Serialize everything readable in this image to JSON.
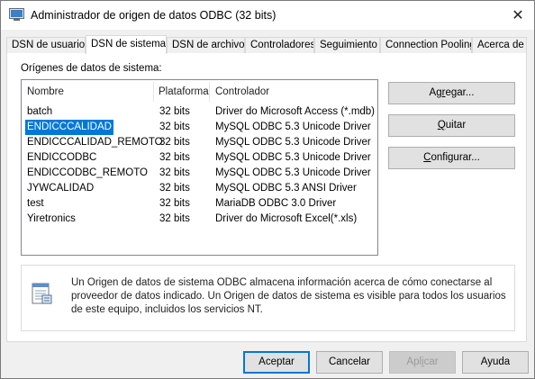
{
  "window": {
    "title": "Administrador de origen de datos ODBC (32 bits)",
    "close_glyph": "✕"
  },
  "tabs": [
    {
      "label": "DSN de usuario"
    },
    {
      "label": "DSN de sistema"
    },
    {
      "label": "DSN de archivo"
    },
    {
      "label": "Controladores"
    },
    {
      "label": "Seguimiento"
    },
    {
      "label": "Connection Pooling"
    },
    {
      "label": "Acerca de"
    }
  ],
  "sources": {
    "group_label": "Orígenes de datos de sistema:",
    "columns": [
      "Nombre",
      "Plataforma",
      "Controlador"
    ],
    "rows": [
      {
        "name": "batch",
        "platform": "32 bits",
        "driver": "Driver do Microsoft Access (*.mdb)"
      },
      {
        "name": "ENDICCCALIDAD",
        "platform": "32 bits",
        "driver": "MySQL ODBC 5.3 Unicode Driver"
      },
      {
        "name": "ENDICCCALIDAD_REMOTO",
        "platform": "32 bits",
        "driver": "MySQL ODBC 5.3 Unicode Driver"
      },
      {
        "name": "ENDICCODBC",
        "platform": "32 bits",
        "driver": "MySQL ODBC 5.3 Unicode Driver"
      },
      {
        "name": "ENDICCODBC_REMOTO",
        "platform": "32 bits",
        "driver": "MySQL ODBC 5.3 Unicode Driver"
      },
      {
        "name": "JYWCALIDAD",
        "platform": "32 bits",
        "driver": "MySQL ODBC 5.3 ANSI Driver"
      },
      {
        "name": "test",
        "platform": "32 bits",
        "driver": "MariaDB ODBC 3.0 Driver"
      },
      {
        "name": "Yiretronics",
        "platform": "32 bits",
        "driver": "Driver do Microsoft Excel(*.xls)"
      }
    ]
  },
  "side_buttons": {
    "add": {
      "pre": "Ag",
      "key": "r",
      "post": "egar..."
    },
    "remove": {
      "pre": "",
      "key": "Q",
      "post": "uitar"
    },
    "configure": {
      "pre": "",
      "key": "C",
      "post": "onfigurar..."
    }
  },
  "info": {
    "icon": "datasource-icon",
    "text": "Un Origen de datos de sistema ODBC almacena información acerca de cómo conectarse al proveedor de datos indicado. Un Origen de datos de sistema es visible para todos los usuarios de este equipo, incluidos los servicios NT."
  },
  "footer": {
    "ok": "Aceptar",
    "cancel": "Cancelar",
    "apply": {
      "pre": "Apl",
      "key": "i",
      "post": "car"
    },
    "help": "Ayuda"
  },
  "selection": {
    "row": "ENDICCCALIDAD"
  },
  "colors": {
    "selection": "#0078d7",
    "default_button_border": "#0078d7"
  }
}
